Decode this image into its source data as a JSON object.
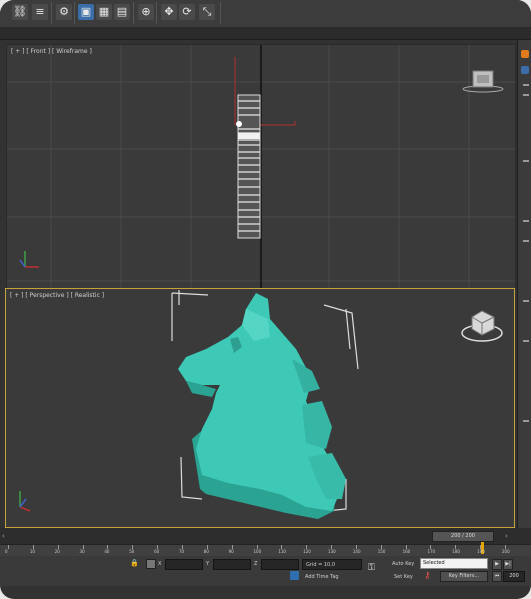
{
  "toolbar": {
    "buttons": [
      {
        "name": "select-and-link-icon",
        "glyph": "⛓"
      },
      {
        "name": "unlink-icon",
        "glyph": "≡"
      },
      {
        "name": "bind-spacewarp-icon",
        "glyph": "⚙"
      },
      {
        "name": "select-object-icon",
        "glyph": "▣"
      },
      {
        "name": "select-by-name-icon",
        "glyph": "▦"
      },
      {
        "name": "rectangular-selection-icon",
        "glyph": "▤"
      },
      {
        "name": "window-crossing-icon",
        "glyph": "⊕"
      },
      {
        "name": "select-and-move-icon",
        "glyph": "✥"
      },
      {
        "name": "select-and-rotate-icon",
        "glyph": "⟳"
      },
      {
        "name": "select-and-scale-icon",
        "glyph": "⤡"
      }
    ]
  },
  "viewports": {
    "front": {
      "label": "[ + ] [ Front ] [ Wireframe ]"
    },
    "perspective": {
      "label": "[ + ] [ Perspective ] [ Realistic ]"
    }
  },
  "timeline": {
    "frame_counter": "200 / 200",
    "ruler_ticks": [
      "0",
      "10",
      "20",
      "30",
      "40",
      "50",
      "60",
      "70",
      "80",
      "90",
      "100",
      "110",
      "120",
      "130",
      "140",
      "150",
      "160",
      "170",
      "180",
      "190",
      "200"
    ]
  },
  "status": {
    "grid": "Grid = 10,0",
    "add_time_tag": "Add Time Tag",
    "auto_key": "Auto Key",
    "set_key": "Set Key",
    "selected_option": "Selected",
    "key_filters": "Key Filters...",
    "x_label": "X",
    "y_label": "Y",
    "z_label": "Z",
    "frame_field": "200"
  },
  "colors": {
    "object": "#3ec8b6",
    "active_border": "#c8a23a"
  }
}
